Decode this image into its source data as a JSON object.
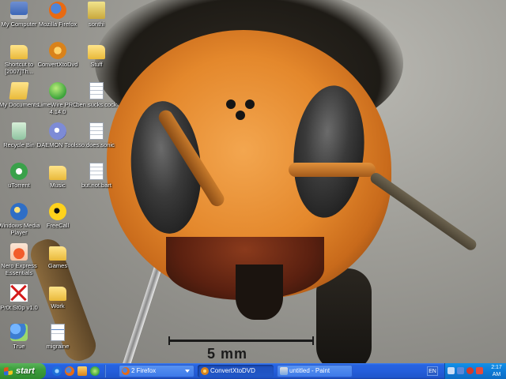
{
  "desktop": {
    "icons": [
      {
        "label": "My Computer",
        "icon": "computer-icon"
      },
      {
        "label": "Mozilla Firefox",
        "icon": "firefox-icon"
      },
      {
        "label": "sonthi",
        "icon": "vlc-media-icon"
      },
      {
        "label": "Shortcut to [2007]Th...",
        "icon": "folder-icon"
      },
      {
        "label": "ConvertXtoDvd",
        "icon": "convertxtodvd-icon"
      },
      {
        "label": "Stuff",
        "icon": "folder-icon"
      },
      {
        "label": "My Documents",
        "icon": "my-documents-icon"
      },
      {
        "label": "LimeWire PRO 4.14.0",
        "icon": "limewire-icon"
      },
      {
        "label": "ben.sucks.cock",
        "icon": "text-file-icon"
      },
      {
        "label": "Recycle Bin",
        "icon": "recycle-bin-icon"
      },
      {
        "label": "DAEMON Tools",
        "icon": "daemon-tools-icon"
      },
      {
        "label": "so.does.sonic",
        "icon": "text-file-icon"
      },
      {
        "label": "uTorrent",
        "icon": "utorrent-icon"
      },
      {
        "label": "Music",
        "icon": "folder-icon"
      },
      {
        "label": "but.not.bart",
        "icon": "text-file-icon"
      },
      {
        "label": "Windows Media Player",
        "icon": "windows-media-player-icon"
      },
      {
        "label": "FreeCall",
        "icon": "freecall-icon"
      },
      {
        "label": "Nero Express Essentials",
        "icon": "nero-icon"
      },
      {
        "label": "Games",
        "icon": "folder-icon"
      },
      {
        "label": "Pr0t.St0p v1.0",
        "icon": "protstop-icon"
      },
      {
        "label": "Work",
        "icon": "folder-icon"
      },
      {
        "label": "True",
        "icon": "true-app-icon"
      },
      {
        "label": "migraine",
        "icon": "document-icon"
      }
    ]
  },
  "wallpaper": {
    "subject": "hornet-macro",
    "scale_label": "5 mm"
  },
  "taskbar": {
    "start_label": "start",
    "quick_launch": [
      "internet-explorer-icon",
      "firefox-icon",
      "convertxtodvd-icon",
      "limewire-icon"
    ],
    "tasks": [
      {
        "label": "2 Firefox",
        "icon": "firefox-icon",
        "active": false
      },
      {
        "label": "ConvertXtoDVD",
        "icon": "convertxtodvd-icon",
        "active": true
      },
      {
        "label": "untitled - Paint",
        "icon": "paint-icon",
        "active": false
      }
    ],
    "language": "EN",
    "clock": {
      "time": "2:17",
      "ampm": "AM"
    }
  },
  "colors": {
    "taskbar_blue": "#245edb",
    "start_green": "#3c9e3c",
    "tray_blue": "#0f7bd6"
  }
}
